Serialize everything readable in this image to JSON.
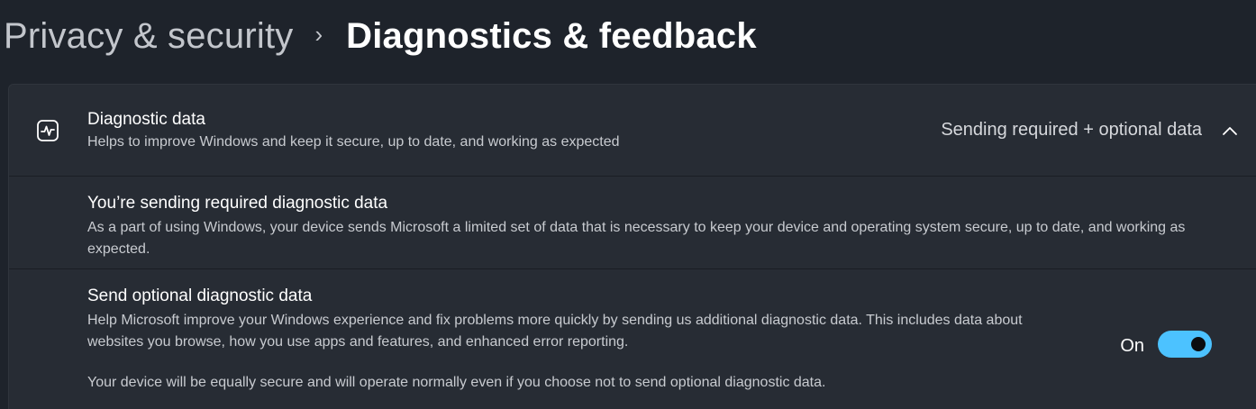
{
  "breadcrumb": {
    "parent": "Privacy & security",
    "separator": "›",
    "current": "Diagnostics & feedback"
  },
  "diagnostic_data": {
    "icon": "activity-pulse-icon",
    "title": "Diagnostic data",
    "description": "Helps to improve Windows and keep it secure, up to date, and working as expected",
    "status": "Sending required + optional data",
    "expanded": true
  },
  "required_section": {
    "title": "You’re sending required diagnostic data",
    "description": "As a part of using Windows, your device sends Microsoft a limited set of data that is necessary to keep your device and operating system secure, up to date, and working as expected."
  },
  "optional_section": {
    "title": "Send optional diagnostic data",
    "description": "Help Microsoft improve your Windows experience and fix problems more quickly by sending us additional diagnostic data. This includes data about websites you browse, how you use apps and features, and enhanced error reporting.",
    "note": "Your device will be equally secure and will operate normally even if you choose not to send optional diagnostic data.",
    "toggle_label": "On",
    "toggle_on": true
  },
  "colors": {
    "background": "#1e232b",
    "card": "#272c34",
    "accent": "#4cc2ff"
  }
}
